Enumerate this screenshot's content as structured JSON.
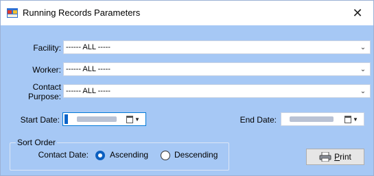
{
  "window": {
    "title": "Running Records Parameters",
    "close_glyph": "✕"
  },
  "fields": {
    "facility": {
      "label": "Facility:",
      "value": "------ ALL -----"
    },
    "worker": {
      "label": "Worker:",
      "value": "------ ALL -----"
    },
    "contact_purpose": {
      "label_line1": "Contact",
      "label_line2": "Purpose:",
      "value": "------ ALL -----"
    }
  },
  "dates": {
    "start_label": "Start Date:",
    "end_label": "End Date:"
  },
  "sort_order": {
    "title": "Sort Order",
    "contact_date_label": "Contact Date:",
    "options": [
      {
        "label": "Ascending",
        "checked": true
      },
      {
        "label": "Descending",
        "checked": false
      }
    ]
  },
  "print_button": {
    "label_underlined": "P",
    "label_rest": "rint"
  },
  "colors": {
    "client_bg": "#a6c8f5",
    "accent": "#0078d7"
  }
}
